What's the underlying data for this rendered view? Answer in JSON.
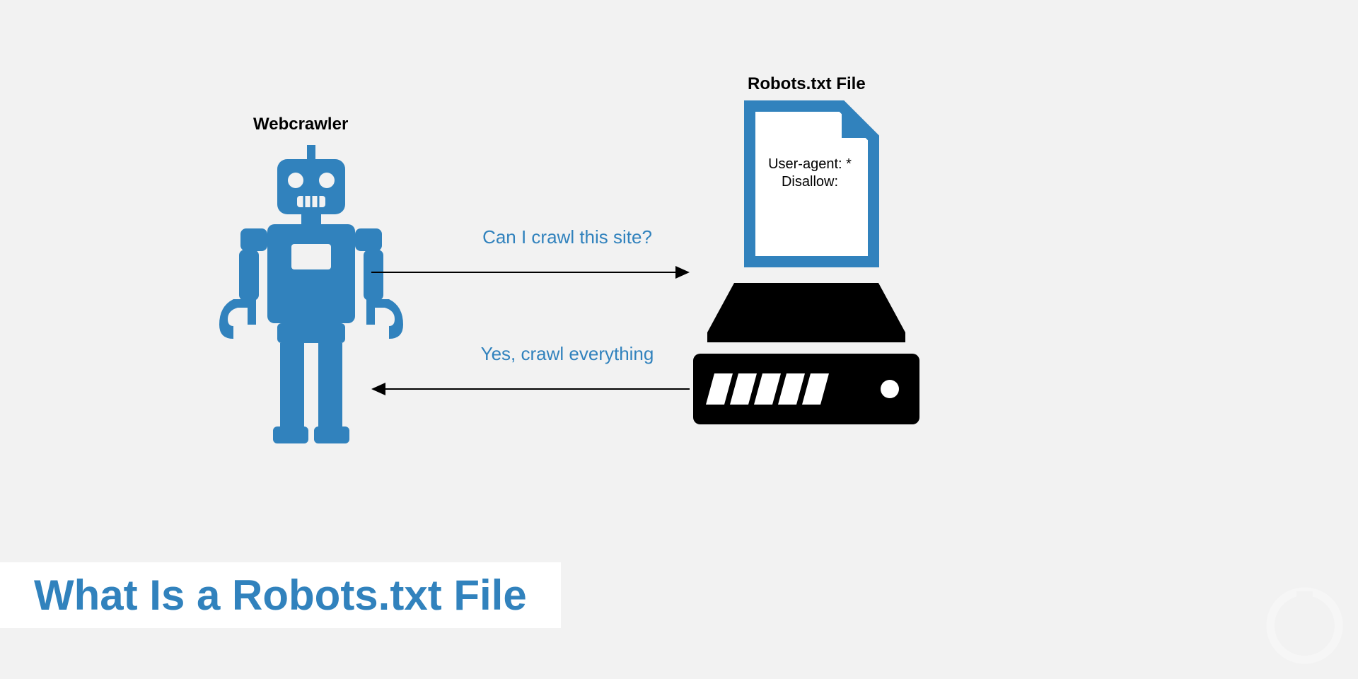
{
  "labels": {
    "webcrawler": "Webcrawler",
    "robots_file": "Robots.txt File"
  },
  "messages": {
    "question": "Can I crawl this site?",
    "answer": "Yes, crawl everything"
  },
  "file_content": {
    "line1": "User-agent: *",
    "line2": "Disallow:"
  },
  "title": "What Is a Robots.txt File",
  "colors": {
    "accent": "#3182bd",
    "bg": "#f2f2f2",
    "black": "#000000"
  }
}
